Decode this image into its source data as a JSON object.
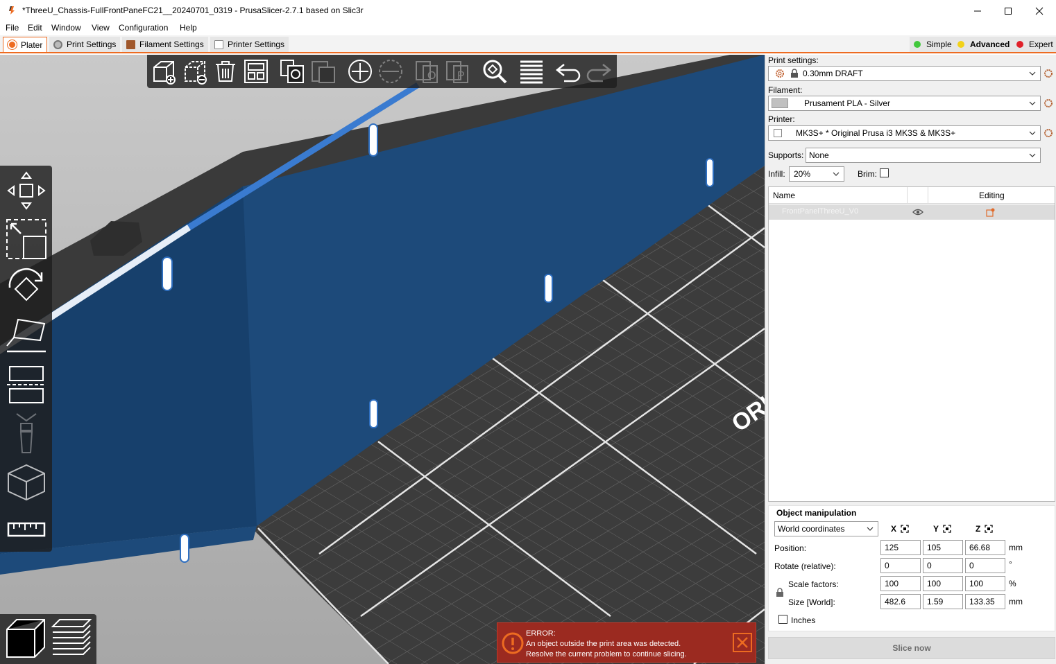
{
  "window": {
    "title": "*ThreeU_Chassis-FullFrontPaneFC21__20240701_0319 - PrusaSlicer-2.7.1 based on Slic3r"
  },
  "menu": [
    "File",
    "Edit",
    "Window",
    "View",
    "Configuration",
    "Help"
  ],
  "tabs": [
    "Plater",
    "Print Settings",
    "Filament Settings",
    "Printer Settings"
  ],
  "modes": {
    "simple": "Simple",
    "advanced": "Advanced",
    "expert": "Expert",
    "active": "Advanced"
  },
  "colors": {
    "accent": "#ed6b21",
    "model": "#1d4a7a",
    "bed": "#3c3c3c",
    "error_bg": "#9b2a20",
    "simple_dot": "#42c83c",
    "advanced_dot": "#f2d21a",
    "expert_dot": "#e0202a"
  },
  "top_toolbar_icons": [
    "add-icon",
    "delete-icon",
    "delete-all-icon",
    "arrange-icon",
    "copy-icon",
    "paste-icon",
    "add-instance-icon",
    "remove-instance-icon",
    "split-objects-icon",
    "split-parts-icon",
    "search-icon",
    "layers-editing-icon",
    "undo-icon",
    "redo-icon"
  ],
  "left_toolbar_icons": [
    "move-icon",
    "scale-icon",
    "rotate-icon",
    "place-on-face-icon",
    "cut-icon",
    "support-paint-icon",
    "seam-paint-icon",
    "measure-icon"
  ],
  "sidebar": {
    "print_settings_label": "Print settings:",
    "print_settings_value": "0.30mm DRAFT",
    "filament_label": "Filament:",
    "filament_value": "Prusament PLA - Silver",
    "printer_label": "Printer:",
    "printer_value": "MK3S+ * Original Prusa i3 MK3S & MK3S+",
    "supports_label": "Supports:",
    "supports_value": "None",
    "infill_label": "Infill:",
    "infill_value": "20%",
    "brim_label": "Brim:",
    "brim_checked": false
  },
  "object_list": {
    "col_name": "Name",
    "col_editing": "Editing",
    "items": [
      {
        "name": "FrontPanelThreeU_V0"
      }
    ]
  },
  "manipulation": {
    "title": "Object manipulation",
    "coord_system": "World coordinates",
    "axes": [
      "X",
      "Y",
      "Z"
    ],
    "position_label": "Position:",
    "position": [
      "125",
      "105",
      "66.68"
    ],
    "position_unit": "mm",
    "rotate_label": "Rotate (relative):",
    "rotate": [
      "0",
      "0",
      "0"
    ],
    "rotate_unit": "°",
    "scale_label": "Scale factors:",
    "scale": [
      "100",
      "100",
      "100"
    ],
    "scale_unit": "%",
    "size_label": "Size [World]:",
    "size": [
      "482.6",
      "1.59",
      "133.35"
    ],
    "size_unit": "mm",
    "inches_label": "Inches"
  },
  "slice_button": "Slice now",
  "error": {
    "heading": "ERROR:",
    "line1": "An object outside the print area was detected.",
    "line2": "Resolve the current problem to continue slicing."
  },
  "bed_text": "ORI"
}
